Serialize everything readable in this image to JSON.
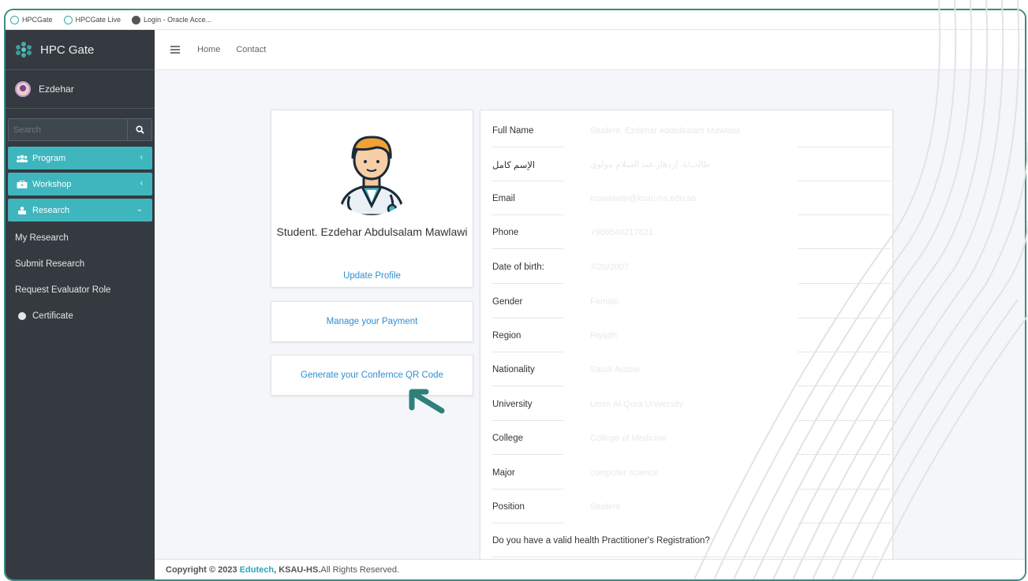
{
  "bookmarks": [
    {
      "label": "HPCGate",
      "icon": "hpc-icon"
    },
    {
      "label": "HPCGate Live",
      "icon": "hpc-icon"
    },
    {
      "label": "Login - Oracle Acce...",
      "icon": "globe-icon"
    }
  ],
  "sidebar": {
    "brand": "HPC Gate",
    "user_name": "Ezdehar",
    "search_placeholder": "Search",
    "menu": [
      {
        "label": "Program",
        "icon": "users-icon",
        "chevron": "‹"
      },
      {
        "label": "Workshop",
        "icon": "briefcase-icon",
        "chevron": "‹"
      },
      {
        "label": "Research",
        "icon": "research-icon",
        "chevron": "⌄"
      }
    ],
    "subitems": [
      {
        "label": "My Research"
      },
      {
        "label": "Submit Research"
      },
      {
        "label": "Request Evaluator Role"
      },
      {
        "label": "Certificate"
      }
    ]
  },
  "topnav": {
    "home": "Home",
    "contact": "Contact"
  },
  "profile": {
    "name": "Student. Ezdehar Abdulsalam Mawlawi",
    "update_link": "Update Profile",
    "payment_link": "Manage your Payment",
    "qr_link": "Generate your Confernce QR Code"
  },
  "details": [
    {
      "label": "Full Name",
      "value": "Student. Ezdehar Abdulsalam Mawlawi"
    },
    {
      "label": "الإسم كامل",
      "value": "طالب/ة. إزدهار عبد السلام مولوي"
    },
    {
      "label": "Email",
      "value": "mawlawie@ksau-hs.edu.sa"
    },
    {
      "label": "Phone",
      "value": "+966540217821"
    },
    {
      "label": "Date of birth:",
      "value": "7/20/2007"
    },
    {
      "label": "Gender",
      "value": "Female"
    },
    {
      "label": "Region",
      "value": "Riyadh"
    },
    {
      "label": "Nationality",
      "value": "Saudi Arabia"
    },
    {
      "label": "University",
      "value": "Umm Al-Qura University"
    },
    {
      "label": "College",
      "value": "College of Medicine"
    },
    {
      "label": "Major",
      "value": "computer science"
    },
    {
      "label": "Position",
      "value": "Student"
    }
  ],
  "question": "Do you have a valid health Practitioner's Registration?",
  "footer": {
    "prefix": "Copyright © 2023 ",
    "brand": "Edutech",
    "org": ", KSAU-HS.",
    "suffix": "All Rights Reserved."
  },
  "colors": {
    "accent": "#3fb6be",
    "sidebar": "#343a40",
    "frame": "#3d8a83",
    "link": "#2e8fd0"
  }
}
